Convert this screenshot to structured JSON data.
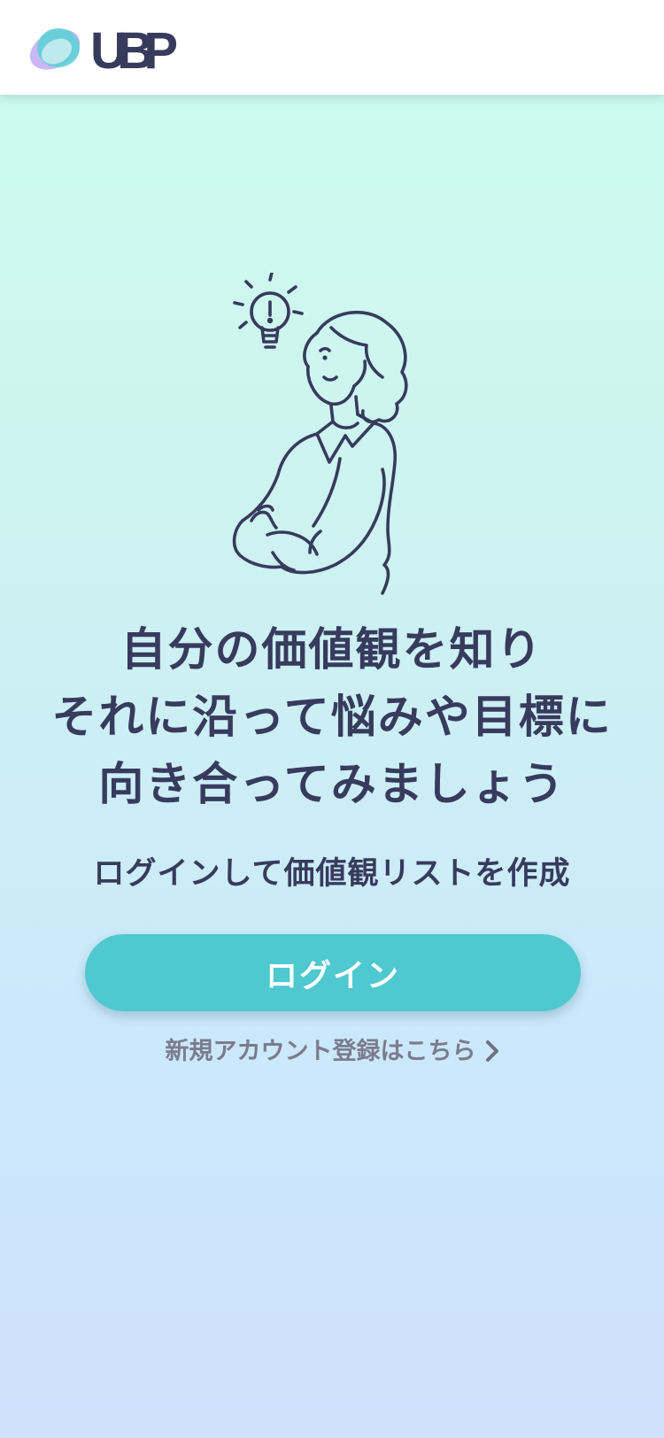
{
  "header": {
    "logo_text": "UBP",
    "logo_colors": {
      "teal": "#5fd0d6",
      "purple": "#c9b8f5",
      "text": "#373b5c"
    }
  },
  "hero": {
    "illustration": "person-with-lightbulb-illustration",
    "headline_lines": [
      "自分の価値観を知り",
      "それに沿って悩みや目標に",
      "向き合ってみましょう"
    ],
    "subtext": "ログインして価値観リストを作成"
  },
  "actions": {
    "login_label": "ログイン",
    "register_label": "新規アカウント登録はこちら",
    "register_icon": "chevron-right-icon"
  },
  "colors": {
    "accent": "#4fc8cf",
    "text_primary": "#373b5c",
    "text_muted": "#7a7c8e",
    "bg_top": "#cdfdee",
    "bg_bottom": "#cfe0fd"
  }
}
